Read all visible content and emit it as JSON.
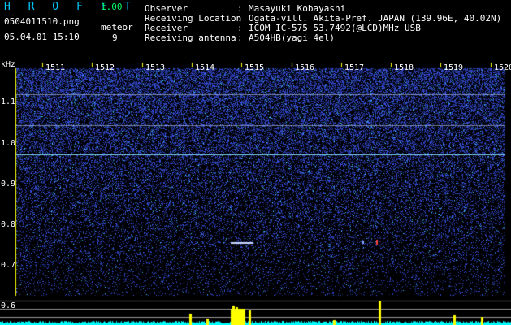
{
  "header": {
    "app_name": "H R O F F T",
    "version": "1.00",
    "filename": "0504011510.png",
    "datetime": "05.04.01 15:10",
    "counter_label": "meteor",
    "counter_value": "9"
  },
  "station": [
    {
      "label": "Observer",
      "value": "Masayuki Kobayashi"
    },
    {
      "label": "Receiving Location",
      "value": "Ogata-vill. Akita-Pref. JAPAN (139.96E, 40.02N)"
    },
    {
      "label": "Receiver",
      "value": "ICOM IC-575 53.7492(@LCD)MHz USB"
    },
    {
      "label": "Receiving antenna",
      "value": "A504HB(yagi 4el)"
    }
  ],
  "spectrogram": {
    "y_unit": "kHz",
    "y_ticks": [
      "1.1",
      "1.0",
      "0.9",
      "0.8",
      "0.7",
      "0.6"
    ],
    "x_ticks": [
      "1511",
      "1512",
      "1513",
      "1514",
      "1515",
      "1516",
      "1517",
      "1518",
      "1519",
      "1520"
    ],
    "colors": {
      "noise": "#2a3aff",
      "carrier": "#ffffff",
      "power": "#00ffff",
      "peak": "#ffff00",
      "grid": "#ffffff",
      "axis": "#ffff00"
    }
  }
}
